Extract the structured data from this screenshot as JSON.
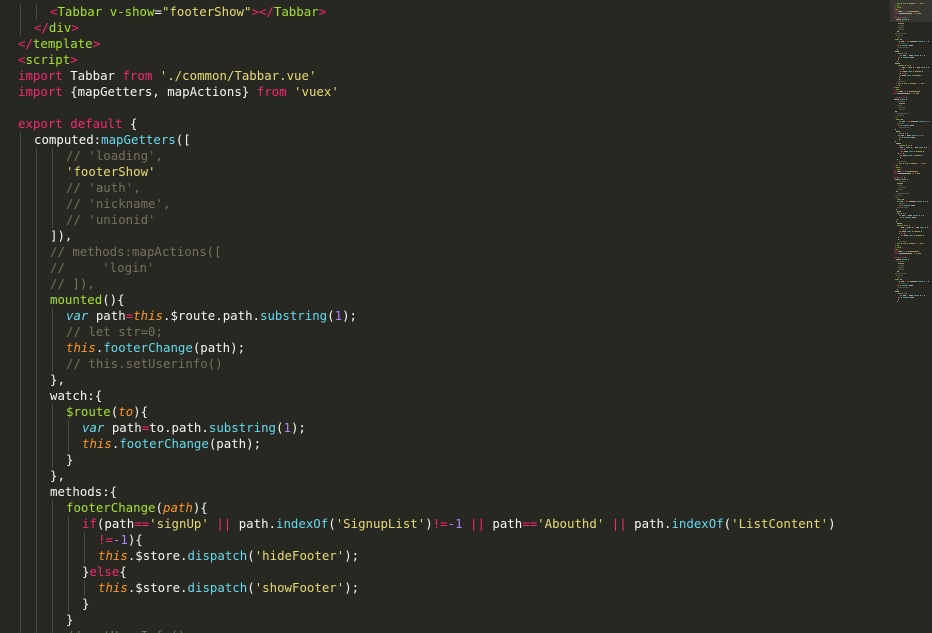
{
  "editor": {
    "theme": "monokai",
    "colors": {
      "background": "#272822",
      "text": "#F8F8F2",
      "tag": "#F92672",
      "attribute": "#A6E22E",
      "string": "#E6DB74",
      "keyword": "#F92672",
      "comment": "#75715E",
      "builtin": "#66D9EF",
      "function_name": "#A6E22E",
      "number": "#AE81FF",
      "this_param": "#FD971F"
    },
    "lines": [
      {
        "indent": 2,
        "tokens": [
          [
            "tag",
            "<"
          ],
          [
            "attr",
            "Tabbar"
          ],
          [
            "text",
            " "
          ],
          [
            "attr",
            "v-show"
          ],
          [
            "text",
            "="
          ],
          [
            "str",
            "\"footerShow\""
          ],
          [
            "tag",
            ">"
          ],
          [
            "tag",
            "</"
          ],
          [
            "attr",
            "Tabbar"
          ],
          [
            "tag",
            ">"
          ]
        ]
      },
      {
        "indent": 1,
        "tokens": [
          [
            "tag",
            "</"
          ],
          [
            "attr",
            "div"
          ],
          [
            "tag",
            ">"
          ]
        ]
      },
      {
        "indent": 0,
        "tokens": [
          [
            "tag",
            "</"
          ],
          [
            "attr",
            "template"
          ],
          [
            "tag",
            ">"
          ]
        ]
      },
      {
        "indent": 0,
        "tokens": [
          [
            "tag",
            "<"
          ],
          [
            "attr",
            "script"
          ],
          [
            "tag",
            ">"
          ]
        ]
      },
      {
        "indent": 0,
        "tokens": [
          [
            "kw",
            "import"
          ],
          [
            "text",
            " Tabbar "
          ],
          [
            "kw",
            "from"
          ],
          [
            "text",
            " "
          ],
          [
            "str",
            "'./common/Tabbar.vue'"
          ]
        ]
      },
      {
        "indent": 0,
        "tokens": [
          [
            "kw",
            "import"
          ],
          [
            "text",
            " {mapGetters, mapActions} "
          ],
          [
            "kw",
            "from"
          ],
          [
            "text",
            " "
          ],
          [
            "str",
            "'vuex'"
          ]
        ]
      },
      {
        "indent": 0,
        "tokens": []
      },
      {
        "indent": 0,
        "tokens": [
          [
            "kw",
            "export"
          ],
          [
            "text",
            " "
          ],
          [
            "kw",
            "default"
          ],
          [
            "text",
            " {"
          ]
        ]
      },
      {
        "indent": 1,
        "tokens": [
          [
            "text",
            "computed:"
          ],
          [
            "fn",
            "mapGetters"
          ],
          [
            "text",
            "(["
          ]
        ]
      },
      {
        "indent": 3,
        "tokens": [
          [
            "cmt",
            "// 'loading',"
          ]
        ]
      },
      {
        "indent": 3,
        "tokens": [
          [
            "str",
            "'footerShow'"
          ]
        ]
      },
      {
        "indent": 3,
        "tokens": [
          [
            "cmt",
            "// 'auth',"
          ]
        ]
      },
      {
        "indent": 3,
        "tokens": [
          [
            "cmt",
            "// 'nickname',"
          ]
        ]
      },
      {
        "indent": 3,
        "tokens": [
          [
            "cmt",
            "// 'unionid'"
          ]
        ]
      },
      {
        "indent": 2,
        "tokens": [
          [
            "text",
            "]),"
          ]
        ]
      },
      {
        "indent": 2,
        "tokens": [
          [
            "cmt",
            "// methods:mapActions(["
          ]
        ]
      },
      {
        "indent": 2,
        "tokens": [
          [
            "cmt",
            "//     'login'"
          ]
        ]
      },
      {
        "indent": 2,
        "tokens": [
          [
            "cmt",
            "// ]),"
          ]
        ]
      },
      {
        "indent": 2,
        "tokens": [
          [
            "name",
            "mounted"
          ],
          [
            "text",
            "(){"
          ]
        ]
      },
      {
        "indent": 3,
        "tokens": [
          [
            "type",
            "var"
          ],
          [
            "text",
            " path"
          ],
          [
            "op",
            "="
          ],
          [
            "this",
            "this"
          ],
          [
            "text",
            ".$route.path."
          ],
          [
            "fn",
            "substring"
          ],
          [
            "text",
            "("
          ],
          [
            "num",
            "1"
          ],
          [
            "text",
            ");"
          ]
        ]
      },
      {
        "indent": 3,
        "tokens": [
          [
            "cmt",
            "// let str=0;"
          ]
        ]
      },
      {
        "indent": 3,
        "tokens": [
          [
            "this",
            "this"
          ],
          [
            "text",
            "."
          ],
          [
            "fn",
            "footerChange"
          ],
          [
            "text",
            "(path);"
          ]
        ]
      },
      {
        "indent": 3,
        "tokens": [
          [
            "cmt",
            "// this.setUserinfo()"
          ]
        ]
      },
      {
        "indent": 2,
        "tokens": [
          [
            "text",
            "},"
          ]
        ]
      },
      {
        "indent": 2,
        "tokens": [
          [
            "text",
            "watch:{"
          ]
        ]
      },
      {
        "indent": 3,
        "tokens": [
          [
            "name",
            "$route"
          ],
          [
            "text",
            "("
          ],
          [
            "param",
            "to"
          ],
          [
            "text",
            "){"
          ]
        ]
      },
      {
        "indent": 4,
        "tokens": [
          [
            "type",
            "var"
          ],
          [
            "text",
            " path"
          ],
          [
            "op",
            "="
          ],
          [
            "text",
            "to.path."
          ],
          [
            "fn",
            "substring"
          ],
          [
            "text",
            "("
          ],
          [
            "num",
            "1"
          ],
          [
            "text",
            ");"
          ]
        ]
      },
      {
        "indent": 4,
        "tokens": [
          [
            "this",
            "this"
          ],
          [
            "text",
            "."
          ],
          [
            "fn",
            "footerChange"
          ],
          [
            "text",
            "(path);"
          ]
        ]
      },
      {
        "indent": 3,
        "tokens": [
          [
            "text",
            "}"
          ]
        ]
      },
      {
        "indent": 2,
        "tokens": [
          [
            "text",
            "},"
          ]
        ]
      },
      {
        "indent": 2,
        "tokens": [
          [
            "text",
            "methods:{"
          ]
        ]
      },
      {
        "indent": 3,
        "tokens": [
          [
            "name",
            "footerChange"
          ],
          [
            "text",
            "("
          ],
          [
            "param",
            "path"
          ],
          [
            "text",
            "){"
          ]
        ]
      },
      {
        "indent": 4,
        "tokens": [
          [
            "kw",
            "if"
          ],
          [
            "text",
            "(path"
          ],
          [
            "op",
            "=="
          ],
          [
            "str",
            "'signUp'"
          ],
          [
            "text",
            " "
          ],
          [
            "op",
            "||"
          ],
          [
            "text",
            " path."
          ],
          [
            "fn",
            "indexOf"
          ],
          [
            "text",
            "("
          ],
          [
            "str",
            "'SignupList'"
          ],
          [
            "text",
            ")"
          ],
          [
            "op",
            "!="
          ],
          [
            "num",
            "-1"
          ],
          [
            "text",
            " "
          ],
          [
            "op",
            "||"
          ],
          [
            "text",
            " path"
          ],
          [
            "op",
            "=="
          ],
          [
            "str",
            "'Abouthd'"
          ],
          [
            "text",
            " "
          ],
          [
            "op",
            "||"
          ],
          [
            "text",
            " path."
          ],
          [
            "fn",
            "indexOf"
          ],
          [
            "text",
            "("
          ],
          [
            "str",
            "'ListContent'"
          ],
          [
            "text",
            ")"
          ]
        ]
      },
      {
        "indent": 5,
        "tokens": [
          [
            "op",
            "!="
          ],
          [
            "num",
            "-1"
          ],
          [
            "text",
            "){"
          ]
        ]
      },
      {
        "indent": 5,
        "tokens": [
          [
            "this",
            "this"
          ],
          [
            "text",
            ".$store."
          ],
          [
            "fn",
            "dispatch"
          ],
          [
            "text",
            "("
          ],
          [
            "str",
            "'hideFooter'"
          ],
          [
            "text",
            ");"
          ]
        ]
      },
      {
        "indent": 4,
        "tokens": [
          [
            "text",
            "}"
          ],
          [
            "kw",
            "else"
          ],
          [
            "text",
            "{"
          ]
        ]
      },
      {
        "indent": 5,
        "tokens": [
          [
            "this",
            "this"
          ],
          [
            "text",
            ".$store."
          ],
          [
            "fn",
            "dispatch"
          ],
          [
            "text",
            "("
          ],
          [
            "str",
            "'showFooter'"
          ],
          [
            "text",
            ");"
          ]
        ]
      },
      {
        "indent": 4,
        "tokens": [
          [
            "text",
            "}"
          ]
        ]
      },
      {
        "indent": 3,
        "tokens": [
          [
            "text",
            "}"
          ]
        ]
      },
      {
        "indent": 3,
        "tokens": [
          [
            "cmt",
            "// getUserInfo()"
          ]
        ]
      }
    ]
  }
}
